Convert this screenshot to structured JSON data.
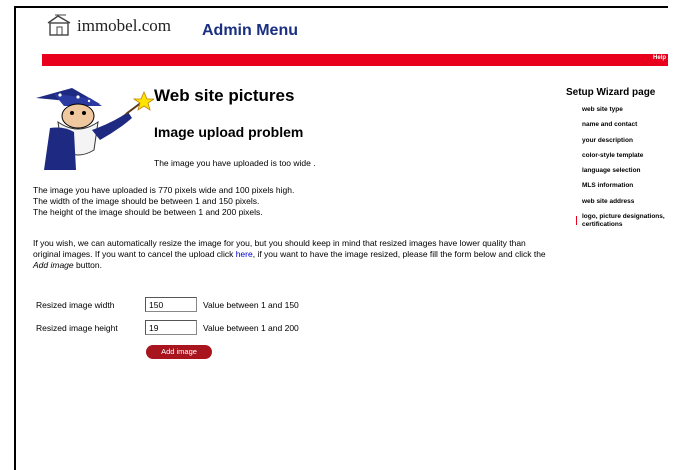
{
  "header": {
    "logo_text": "immobel.com",
    "title": "Admin Menu",
    "help_link": "Help"
  },
  "page": {
    "title": "Web site pictures",
    "subtitle": "Image upload problem",
    "short_message": "The image you have uploaded is too wide ."
  },
  "details": {
    "line1": "The image you have uploaded is 770 pixels wide and 100 pixels high.",
    "line2": "The width of the image should be between 1 and 150 pixels.",
    "line3": "The height of the image should be between 1 and 200 pixels."
  },
  "resize_info": {
    "part1": "If you wish, we can automatically resize the image for you, but you should keep in mind that resized images have lower quality than original images. If you want to cancel the upload click ",
    "link": "here",
    "part2": ", if you want to have the image resized, please fill the form below and click the ",
    "emph": "Add image",
    "part3": " button."
  },
  "form": {
    "width_label": "Resized image width",
    "width_value": "150",
    "width_hint": "Value between 1 and 150",
    "height_label": "Resized image height",
    "height_value": "19",
    "height_hint": "Value between 1 and 200",
    "submit_label": "Add image"
  },
  "sidebar": {
    "title": "Setup Wizard page",
    "items": [
      {
        "label": "web site type"
      },
      {
        "label": "name and contact"
      },
      {
        "label": "your description"
      },
      {
        "label": "color-style template"
      },
      {
        "label": "language selection"
      },
      {
        "label": "MLS information"
      },
      {
        "label": "web site address"
      },
      {
        "label": "logo, picture designations, certifications",
        "active": true
      }
    ]
  },
  "colors": {
    "accent_red": "#e8001c",
    "button_red": "#a8151f",
    "title_blue": "#1a2f80",
    "link_blue": "#0000cc"
  },
  "icons": {
    "logo": "house-logo-icon",
    "wizard": "wizard-illustration"
  }
}
